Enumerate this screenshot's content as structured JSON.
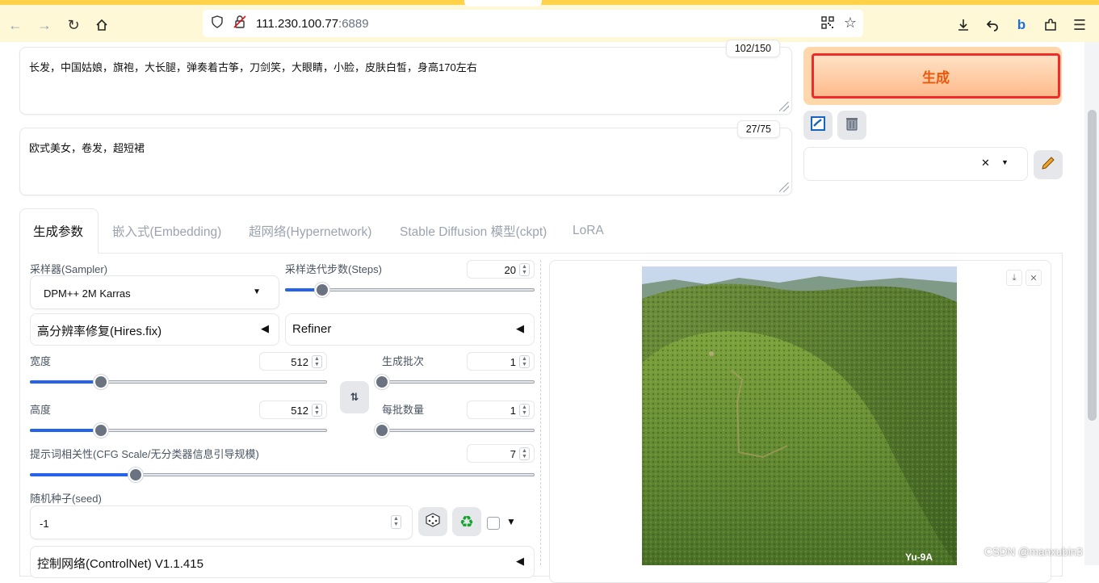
{
  "browser": {
    "url_host": "111.230.100.77",
    "url_port": ":6889"
  },
  "prompts": {
    "positive": "长发，中国姑娘，旗袍，大长腿，弹奏着古筝，刀剑笑，大眼睛，小脸，皮肤白皙，身高170左右",
    "positive_counter": "102/150",
    "negative": "欧式美女，卷发，超短裙",
    "negative_counter": "27/75"
  },
  "actions": {
    "generate": "生成"
  },
  "tabs": [
    {
      "label": "生成参数"
    },
    {
      "label": "嵌入式(Embedding)"
    },
    {
      "label": "超网络(Hypernetwork)"
    },
    {
      "label": "Stable Diffusion 模型(ckpt)"
    },
    {
      "label": "LoRA"
    }
  ],
  "params": {
    "sampler_label": "采样器(Sampler)",
    "sampler_value": "DPM++ 2M Karras",
    "steps_label": "采样迭代步数(Steps)",
    "steps_value": "20",
    "steps_level": 0.15,
    "hires_label": "高分辨率修复(Hires.fix)",
    "refiner_label": "Refiner",
    "width_label": "宽度",
    "width_value": "512",
    "width_level": 0.24,
    "height_label": "高度",
    "height_value": "512",
    "height_level": 0.24,
    "batch_count_label": "生成批次",
    "batch_count_value": "1",
    "batch_count_level": 0.0,
    "batch_size_label": "每批数量",
    "batch_size_value": "1",
    "batch_size_level": 0.0,
    "cfg_label": "提示词相关性(CFG Scale/无分类器信息引导规模)",
    "cfg_value": "7",
    "cfg_level": 0.21,
    "seed_label": "随机种子(seed)",
    "seed_value": "-1",
    "controlnet_label": "控制网络(ControlNet) V1.1.415"
  },
  "watermark": "CSDN @manxubin3",
  "image_overlay_text": "Yu-9A"
}
